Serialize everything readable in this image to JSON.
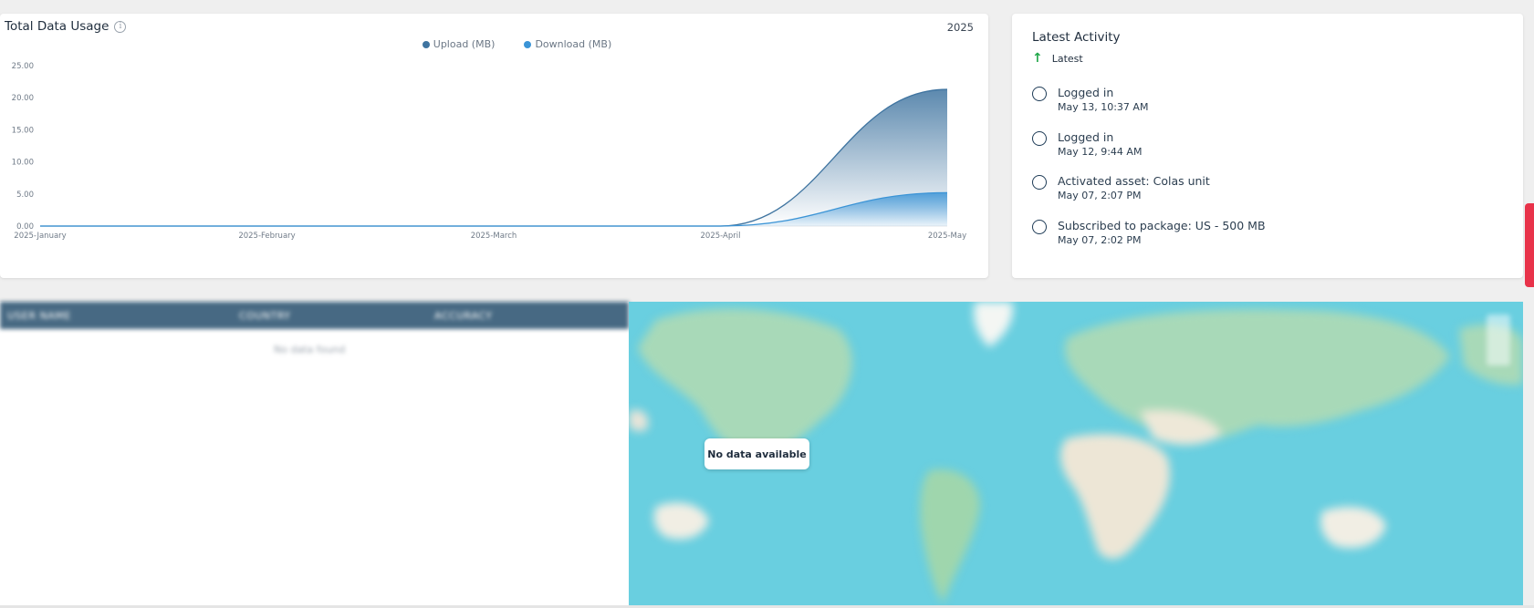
{
  "usage": {
    "title": "Total Data Usage",
    "year": "2025",
    "legend": [
      {
        "label": "Upload (MB)",
        "color": "#3f74a0"
      },
      {
        "label": "Download (MB)",
        "color": "#3b94d6"
      }
    ]
  },
  "chart_data": {
    "type": "area",
    "categories": [
      "2025-January",
      "2025-February",
      "2025-March",
      "2025-April",
      "2025-May"
    ],
    "series": [
      {
        "name": "Upload (MB)",
        "values": [
          0,
          0,
          0,
          0,
          21.3
        ],
        "color": "#3f74a0"
      },
      {
        "name": "Download (MB)",
        "values": [
          0,
          0,
          0,
          0,
          5.2
        ],
        "color": "#3b94d6"
      }
    ],
    "y_ticks": [
      "0.00",
      "5.00",
      "10.00",
      "15.00",
      "20.00",
      "25.00"
    ],
    "ylim": [
      0,
      25
    ],
    "legend_position": "top-center"
  },
  "activity": {
    "title": "Latest Activity",
    "sort_label": "Latest",
    "items": [
      {
        "label": "Logged in",
        "date": "May 13, 10:37 AM"
      },
      {
        "label": "Logged in",
        "date": "May 12, 9:44 AM"
      },
      {
        "label": "Activated asset: Colas unit",
        "date": "May 07, 2:07 PM"
      },
      {
        "label": "Subscribed to package: US - 500 MB",
        "date": "May 07, 2:02 PM"
      }
    ]
  },
  "table": {
    "headers": [
      "USER NAME",
      "COUNTRY",
      "ACCURACY"
    ],
    "empty_text": "No data found"
  },
  "map": {
    "no_data_text": "No data available"
  }
}
